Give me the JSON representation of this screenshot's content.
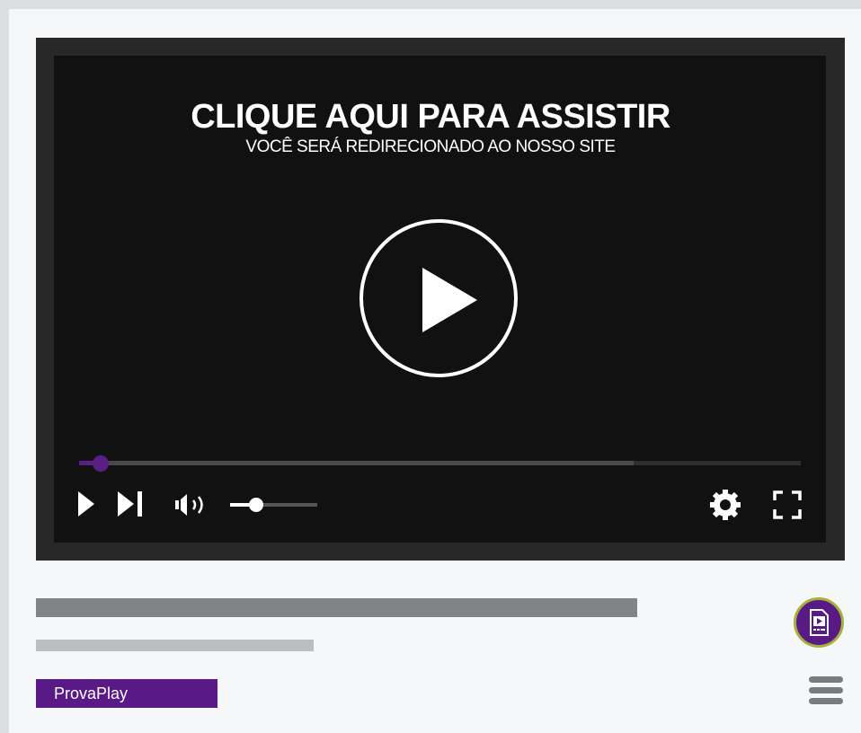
{
  "player": {
    "headline": "CLIQUE AQUI PARA ASSISTIR",
    "subline": "VOCÊ SERÁ REDIRECIONADO AO NOSSO SITE",
    "progress_fraction": 0.03,
    "buffered_fraction": 0.768,
    "volume_fraction": 0.3,
    "accent_color": "#5a1f83",
    "icons": {
      "big_play": "play-circle-icon",
      "play": "play-icon",
      "next": "skip-next-icon",
      "volume": "volume-icon",
      "settings": "gear-icon",
      "fullscreen": "fullscreen-icon"
    }
  },
  "details": {
    "brand_label": "ProvaPlay",
    "brand_color": "#5a1a86",
    "badge_icon": "video-file-icon",
    "menu_icon": "hamburger-menu-icon"
  }
}
